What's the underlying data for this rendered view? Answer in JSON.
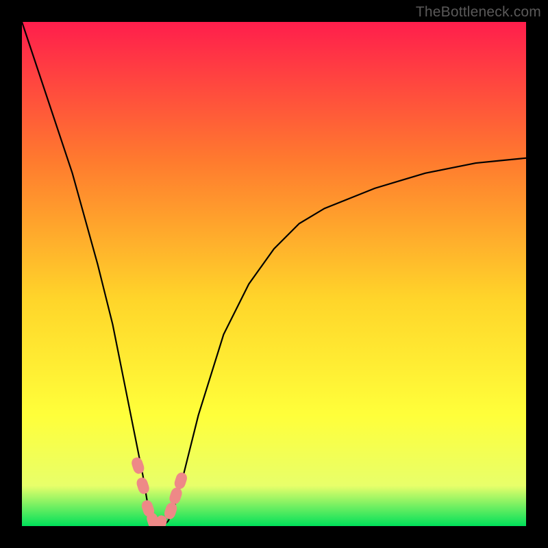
{
  "watermark": {
    "text": "TheBottleneck.com"
  },
  "gradient_colors": {
    "top": "#ff1e4c",
    "mid_upper": "#ff7c2e",
    "mid": "#ffd52a",
    "mid_lower": "#ffff3a",
    "near_bottom": "#e8ff6a",
    "bottom": "#00e05a"
  },
  "chart_data": {
    "type": "line",
    "title": "",
    "xlabel": "",
    "ylabel": "",
    "xlim": [
      0,
      100
    ],
    "ylim": [
      0,
      100
    ],
    "series": [
      {
        "name": "bottleneck-curve",
        "x": [
          0,
          5,
          10,
          15,
          18,
          20,
          22,
          24,
          25,
          26,
          27,
          28,
          29,
          30,
          32,
          35,
          40,
          45,
          50,
          55,
          60,
          65,
          70,
          75,
          80,
          85,
          90,
          95,
          100
        ],
        "values": [
          100,
          85,
          70,
          52,
          40,
          30,
          20,
          10,
          4,
          1,
          0,
          0,
          1,
          3,
          10,
          22,
          38,
          48,
          55,
          60,
          63,
          65,
          67,
          68.5,
          70,
          71,
          72,
          72.5,
          73
        ]
      }
    ],
    "markers": [
      {
        "x": 23.0,
        "y": 12.0
      },
      {
        "x": 24.0,
        "y": 8.0
      },
      {
        "x": 25.0,
        "y": 3.5
      },
      {
        "x": 26.0,
        "y": 1.0
      },
      {
        "x": 27.5,
        "y": 0.5
      },
      {
        "x": 29.5,
        "y": 3.0
      },
      {
        "x": 30.5,
        "y": 6.0
      },
      {
        "x": 31.5,
        "y": 9.0
      }
    ],
    "marker_color": "#ee8987",
    "curve_color": "#000000",
    "grid": false,
    "legend": false
  }
}
